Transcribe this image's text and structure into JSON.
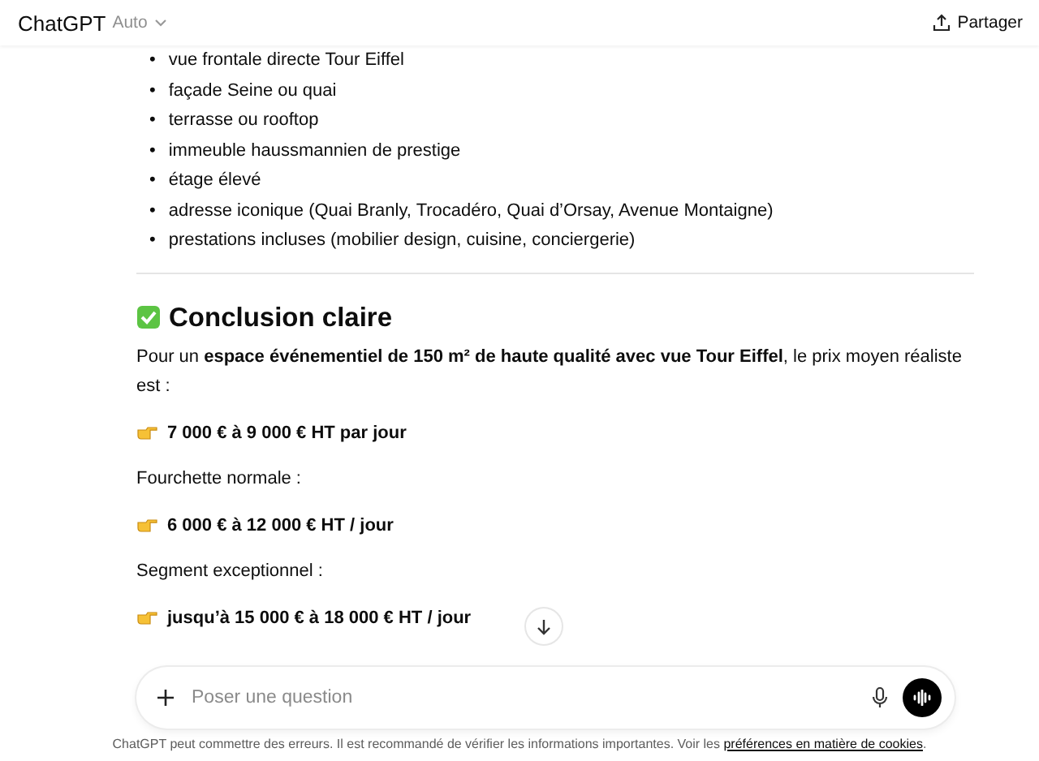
{
  "header": {
    "title": "ChatGPT",
    "model": "Auto",
    "share": "Partager"
  },
  "message": {
    "marker": "•",
    "bullets": [
      "vue frontale directe Tour Eiffel",
      "façade Seine ou quai",
      "terrasse ou rooftop",
      "immeuble haussmannien de prestige",
      "étage élevé",
      "adresse iconique (Quai Branly, Trocadéro, Quai d’Orsay, Avenue Montaigne)",
      "prestations incluses (mobilier design, cuisine, conciergerie)"
    ],
    "heading": "Conclusion claire",
    "blocks": [
      {
        "kind": "paragraph",
        "text": "Pour un **espace événementiel de 150 m² de haute qualité avec vue Tour Eiffel**, le prix moyen réaliste est :"
      },
      {
        "kind": "pointer",
        "text": "7 000 € à 9 000 € HT par jour"
      },
      {
        "kind": "paragraph",
        "text": "Fourchette normale :"
      },
      {
        "kind": "pointer",
        "text": "6 000 € à 12 000 € HT / jour"
      },
      {
        "kind": "paragraph",
        "text": "Segment exceptionnel :"
      },
      {
        "kind": "pointer",
        "text": "jusqu’à 15 000 € à 18 000 € HT / jour"
      }
    ]
  },
  "composer": {
    "placeholder": "Poser une question"
  },
  "footer": {
    "text": "ChatGPT peut commettre des erreurs. Il est recommandé de vérifier les informations importantes. Voir les ",
    "link": "préférences en matière de cookies",
    "end": "."
  }
}
